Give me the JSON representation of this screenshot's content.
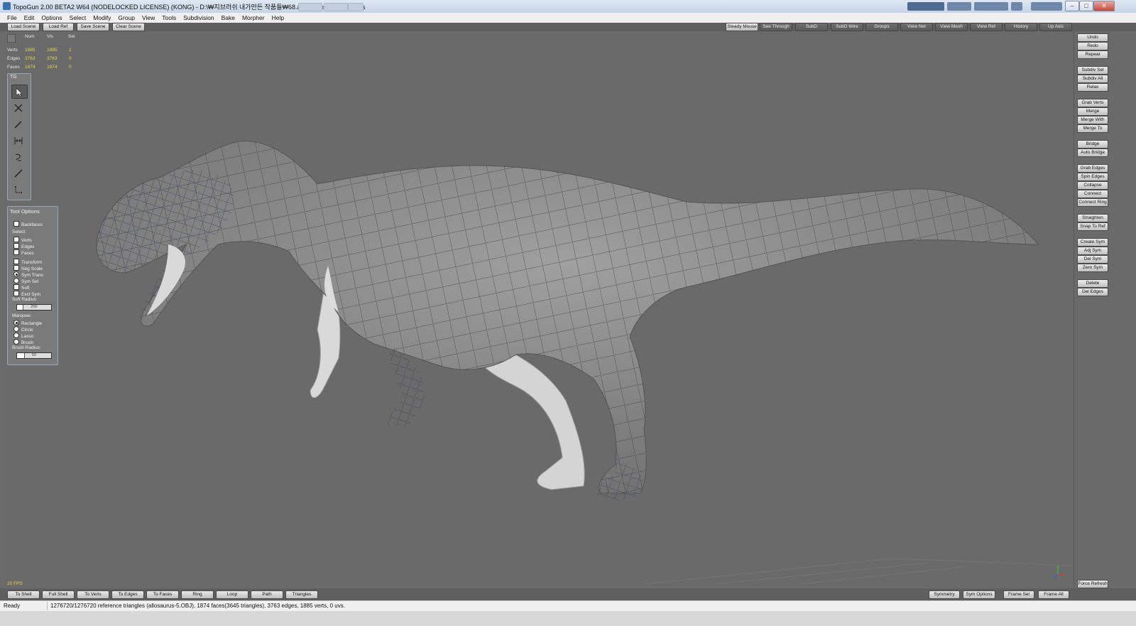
{
  "window": {
    "title": "TopoGun 2.00 BETA2 W64  (NODELOCKED LICENSE) (KONG) - D:\\₩지브러쉬 내가만든 작품들₩68.allosaurus₩allo_re1.tgs"
  },
  "menu": [
    "File",
    "Edit",
    "Options",
    "Select",
    "Modify",
    "Group",
    "View",
    "Tools",
    "Subdivision",
    "Bake",
    "Morpher",
    "Help"
  ],
  "scene_buttons": [
    "Load Scene",
    "Load Ref",
    "Save Scene",
    "Clear Scene"
  ],
  "view_buttons": [
    "Steady Mouse",
    "See Through",
    "SubD",
    "SubD Wire",
    "Groups",
    "View Net",
    "View Mesh",
    "View Ref",
    "History",
    "Up Axis"
  ],
  "stats": {
    "headers": [
      "Num",
      "Vis",
      "Sel"
    ],
    "rows": [
      {
        "label": "Verts",
        "num": "1885",
        "vis": "1885",
        "sel": "1"
      },
      {
        "label": "Edges",
        "num": "3763",
        "vis": "3763",
        "sel": "0"
      },
      {
        "label": "Faces",
        "num": "1874",
        "vis": "1874",
        "sel": "0"
      }
    ]
  },
  "tool_panel": {
    "title": "TG"
  },
  "tool_options": {
    "title": "Tool Options",
    "backfaces": "Backfaces",
    "select_label": "Select:",
    "select_items": [
      "Verts",
      "Edges",
      "Faces"
    ],
    "transform_items": [
      {
        "label": "Transform",
        "kind": "check",
        "on": false
      },
      {
        "label": "Neg Scale",
        "kind": "check",
        "on": false
      },
      {
        "label": "Sym Trans",
        "kind": "radio",
        "on": true
      },
      {
        "label": "Sym Sel",
        "kind": "radio",
        "on": false
      },
      {
        "label": "Soft",
        "kind": "check",
        "on": false
      },
      {
        "label": "Excl Sym",
        "kind": "check",
        "on": false
      }
    ],
    "soft_radius_label": "Soft Radius:",
    "soft_radius_value": "200",
    "marquee_label": "Marquee:",
    "marquee_items": [
      {
        "label": "Rectangle",
        "on": true
      },
      {
        "label": "Circle",
        "on": false
      },
      {
        "label": "Lasso",
        "on": false
      },
      {
        "label": "Brush",
        "on": false
      }
    ],
    "brush_radius_label": "Brush Radius:",
    "brush_radius_value": "50"
  },
  "right_buttons": [
    [
      "Undo",
      "Redo",
      "Repeat"
    ],
    [
      "Subdiv Sel",
      "Subdiv All",
      "Relax"
    ],
    [
      "Grab Verts",
      "Merge",
      "Merge With",
      "Merge To"
    ],
    [
      "Bridge",
      "Auto Bridge"
    ],
    [
      "Grab Edges",
      "Spin Edges",
      "Collapse",
      "Connect",
      "Connect Ring"
    ],
    [
      "Straighten",
      "Snap To Ref"
    ],
    [
      "Create Sym",
      "Adj Sym",
      "Del Sym",
      "Zero Sym"
    ],
    [
      "Delete",
      "Del Edges"
    ]
  ],
  "force_refresh": "Force Refresh",
  "fps": "20 FPS",
  "bottom_left_buttons": [
    "To Shell",
    "Full Shell",
    "To Verts",
    "To Edges",
    "To Faces",
    "Ring",
    "Loop",
    "Path",
    "Triangles"
  ],
  "bottom_right_buttons": [
    "Symmetry",
    "Sym Options",
    "Frame Sel",
    "Frame All"
  ],
  "status": {
    "state": "Ready",
    "info": "1276720/1276720 reference triangles (allosaurus-5.OBJ), 1874 faces(3645 triangles), 3763 edges, 1885 verts, 0 uvs."
  },
  "colors": {
    "wire": "#3a78d6",
    "model": "#8a8a8a",
    "viewport": "#6a6a6a",
    "stat_value": "#e4d83b"
  }
}
